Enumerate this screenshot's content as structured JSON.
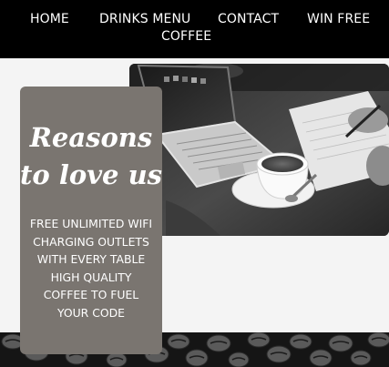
{
  "nav": {
    "items": [
      {
        "label": "HOME"
      },
      {
        "label": "DRINKS MENU"
      },
      {
        "label": "CONTACT"
      },
      {
        "label": "WIN FREE"
      },
      {
        "label": "COFFEE"
      }
    ]
  },
  "reasons": {
    "title_line1": "Reasons",
    "title_line2": "to love us",
    "items": [
      "FREE UNLIMITED WIFI",
      "CHARGING OUTLETS",
      "WITH EVERY TABLE",
      "HIGH QUALITY",
      "COFFEE TO FUEL",
      "YOUR CODE"
    ],
    "card_color": "#7a7570"
  },
  "theme": {
    "nav_background": "#000000",
    "page_background": "#f4f4f4",
    "text_color": "#ffffff"
  }
}
